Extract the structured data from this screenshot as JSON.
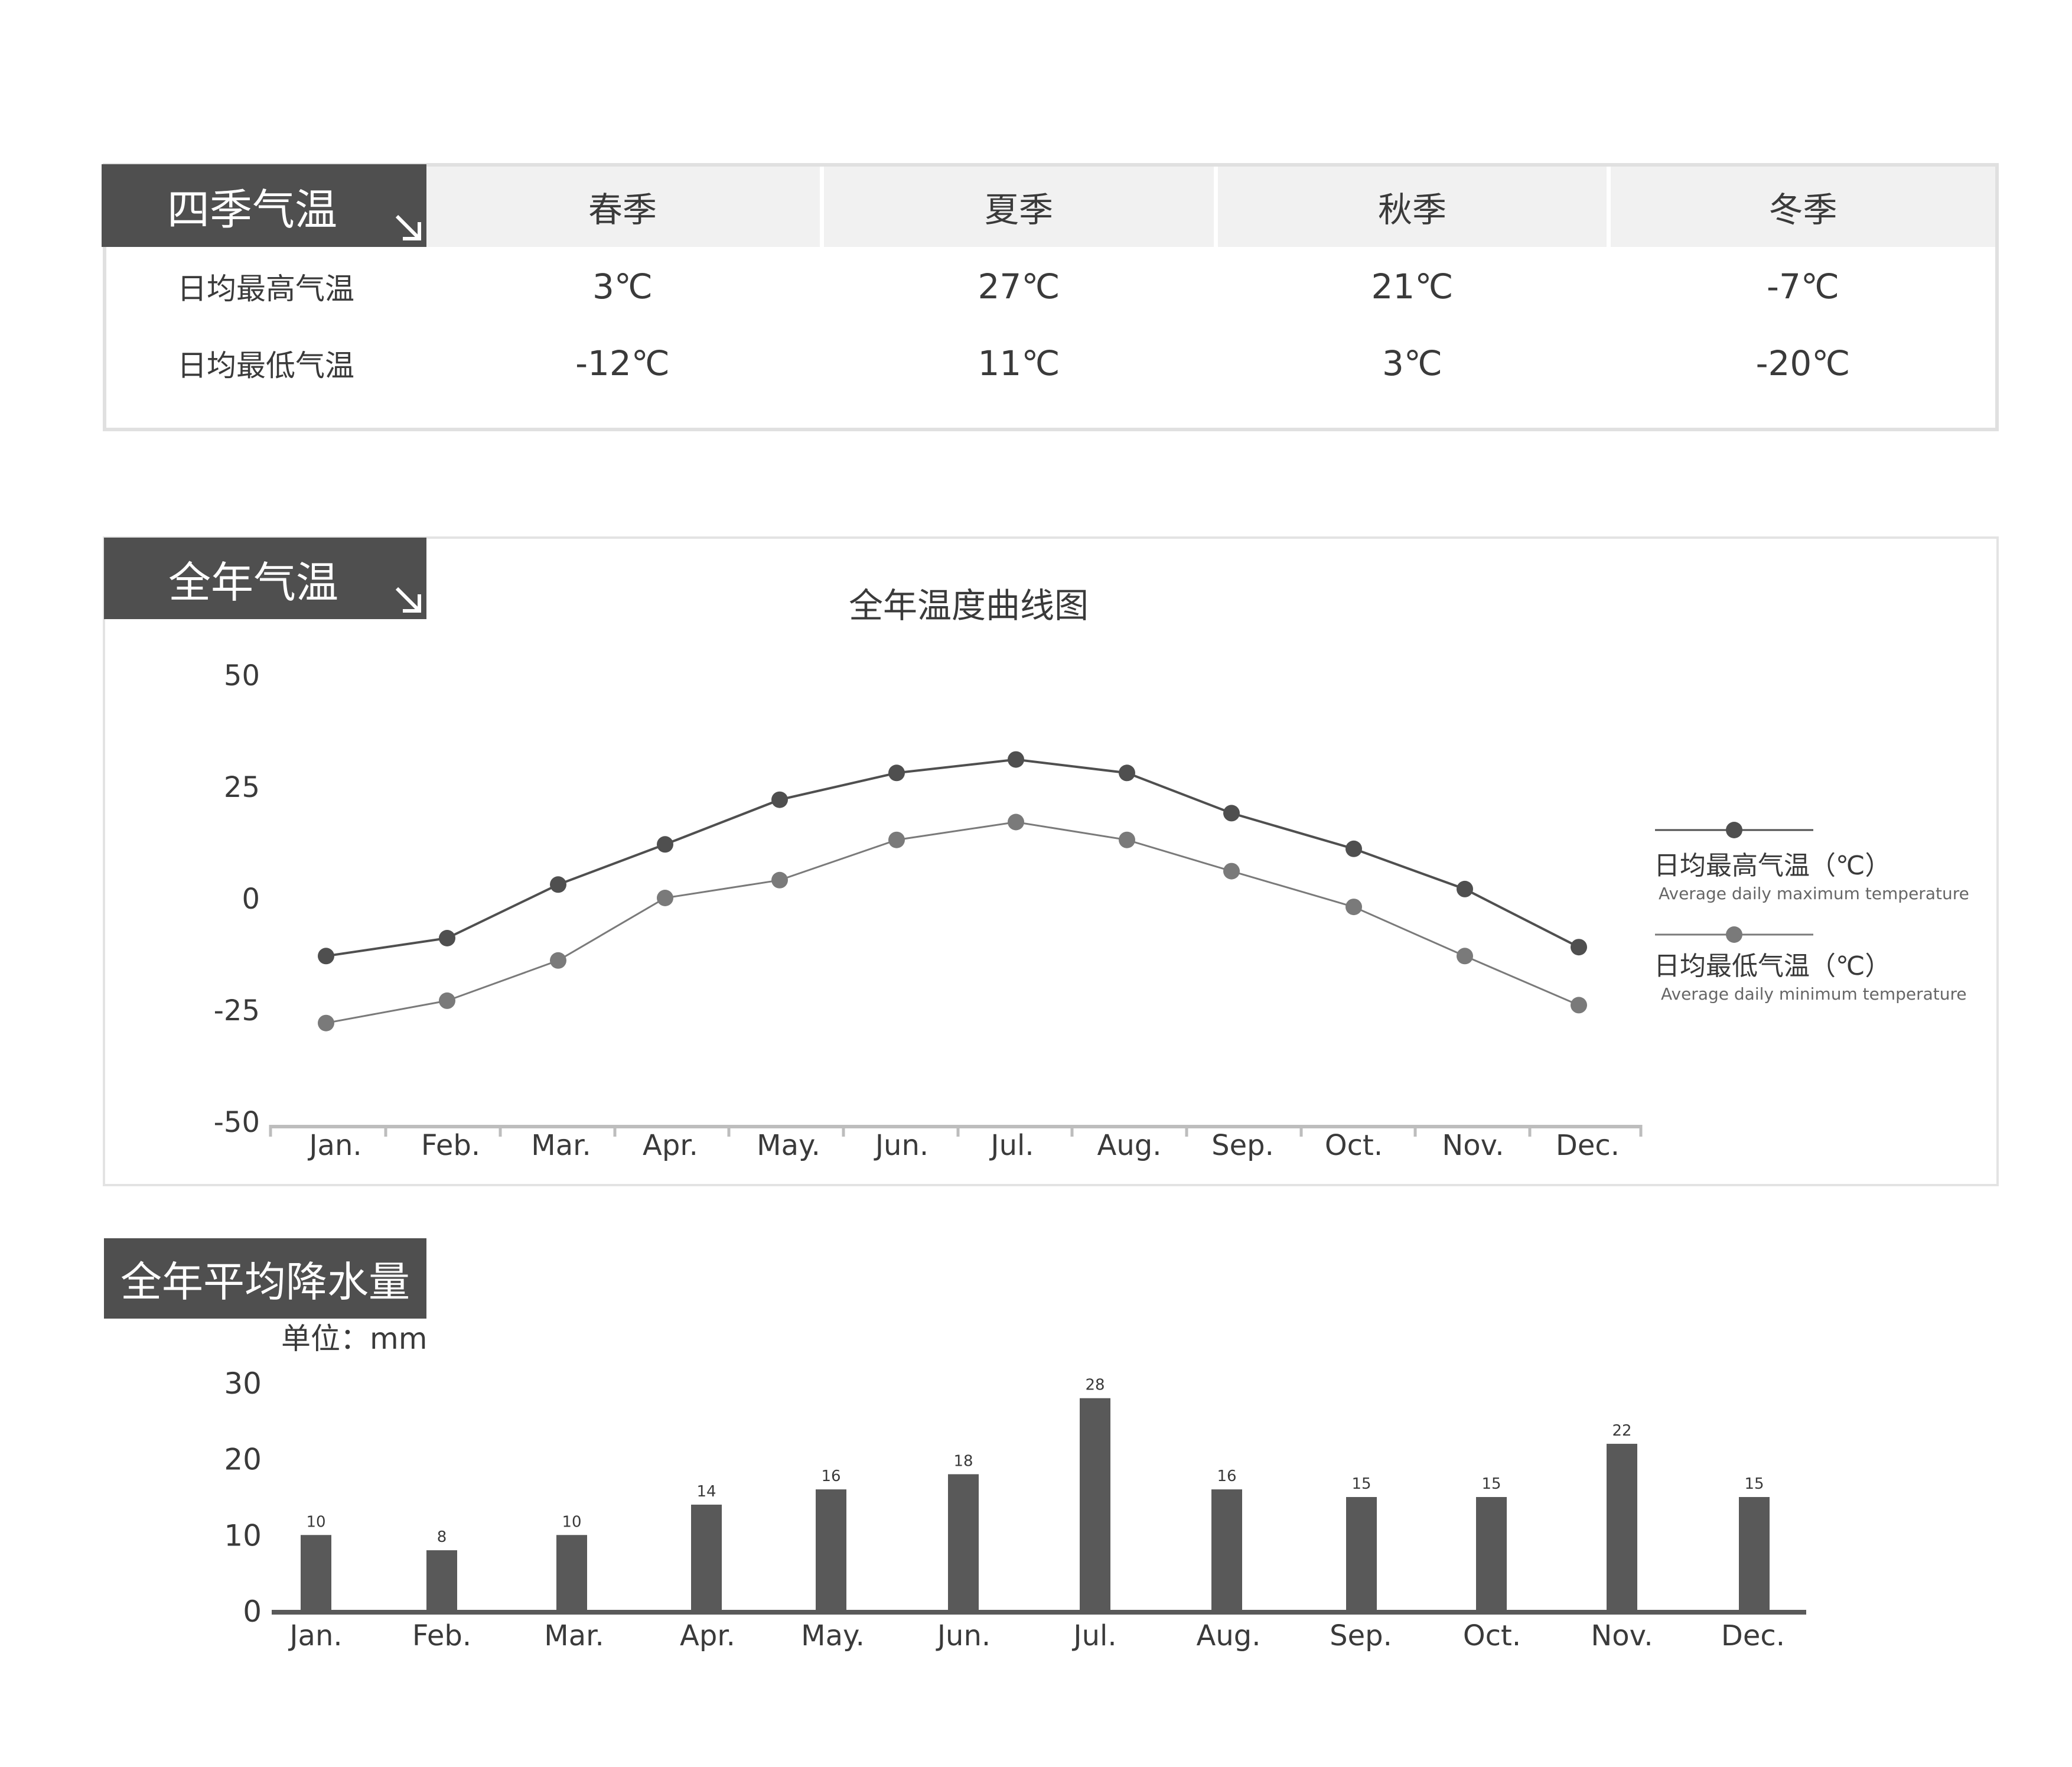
{
  "seasons": {
    "tag": "四季气温",
    "columns": [
      "春季",
      "夏季",
      "秋季",
      "冬季"
    ],
    "rows": [
      {
        "label": "日均最高气温",
        "values": [
          "3℃",
          "27℃",
          "21℃",
          "-7℃"
        ]
      },
      {
        "label": "日均最低气温",
        "values": [
          "-12℃",
          "11℃",
          "3℃",
          "-20℃"
        ]
      }
    ]
  },
  "temp_section": {
    "tag": "全年气温"
  },
  "rain_section": {
    "tag": "全年平均降水量",
    "unit": "单位：mm"
  },
  "colors": {
    "dark": "#4f4f4f",
    "mid": "#7a7a7a",
    "bar": "#595959",
    "panel_border": "#e0e0e0"
  },
  "chart_data": [
    {
      "type": "line",
      "title": "全年温度曲线图",
      "categories": [
        "Jan.",
        "Feb.",
        "Mar.",
        "Apr.",
        "May.",
        "Jun.",
        "Jul.",
        "Aug.",
        "Sep.",
        "Oct.",
        "Nov.",
        "Dec."
      ],
      "ylim": [
        -50,
        50
      ],
      "yticks": [
        "50",
        "25",
        "0",
        "-25",
        "-50"
      ],
      "grid": false,
      "legend_placement": "right",
      "series": [
        {
          "name": "日均最高气温（℃）",
          "subtitle": "Average daily maximum temperature",
          "values": [
            -13,
            -9,
            3,
            12,
            22,
            28,
            31,
            28,
            19,
            11,
            2,
            -11
          ]
        },
        {
          "name": "日均最低气温（℃）",
          "subtitle": "Average daily minimum temperature",
          "values": [
            -28,
            -23,
            -14,
            0,
            4,
            13,
            17,
            13,
            6,
            -2,
            -13,
            -24
          ]
        }
      ]
    },
    {
      "type": "bar",
      "categories": [
        "Jan.",
        "Feb.",
        "Mar.",
        "Apr.",
        "May.",
        "Jun.",
        "Jul.",
        "Aug.",
        "Sep.",
        "Oct.",
        "Nov.",
        "Dec."
      ],
      "values": [
        10,
        8,
        10,
        14,
        16,
        18,
        28,
        16,
        15,
        15,
        22,
        15
      ],
      "ylim": [
        0,
        30
      ],
      "yticks": [
        "30",
        "20",
        "10",
        "0"
      ],
      "grid": false
    }
  ]
}
